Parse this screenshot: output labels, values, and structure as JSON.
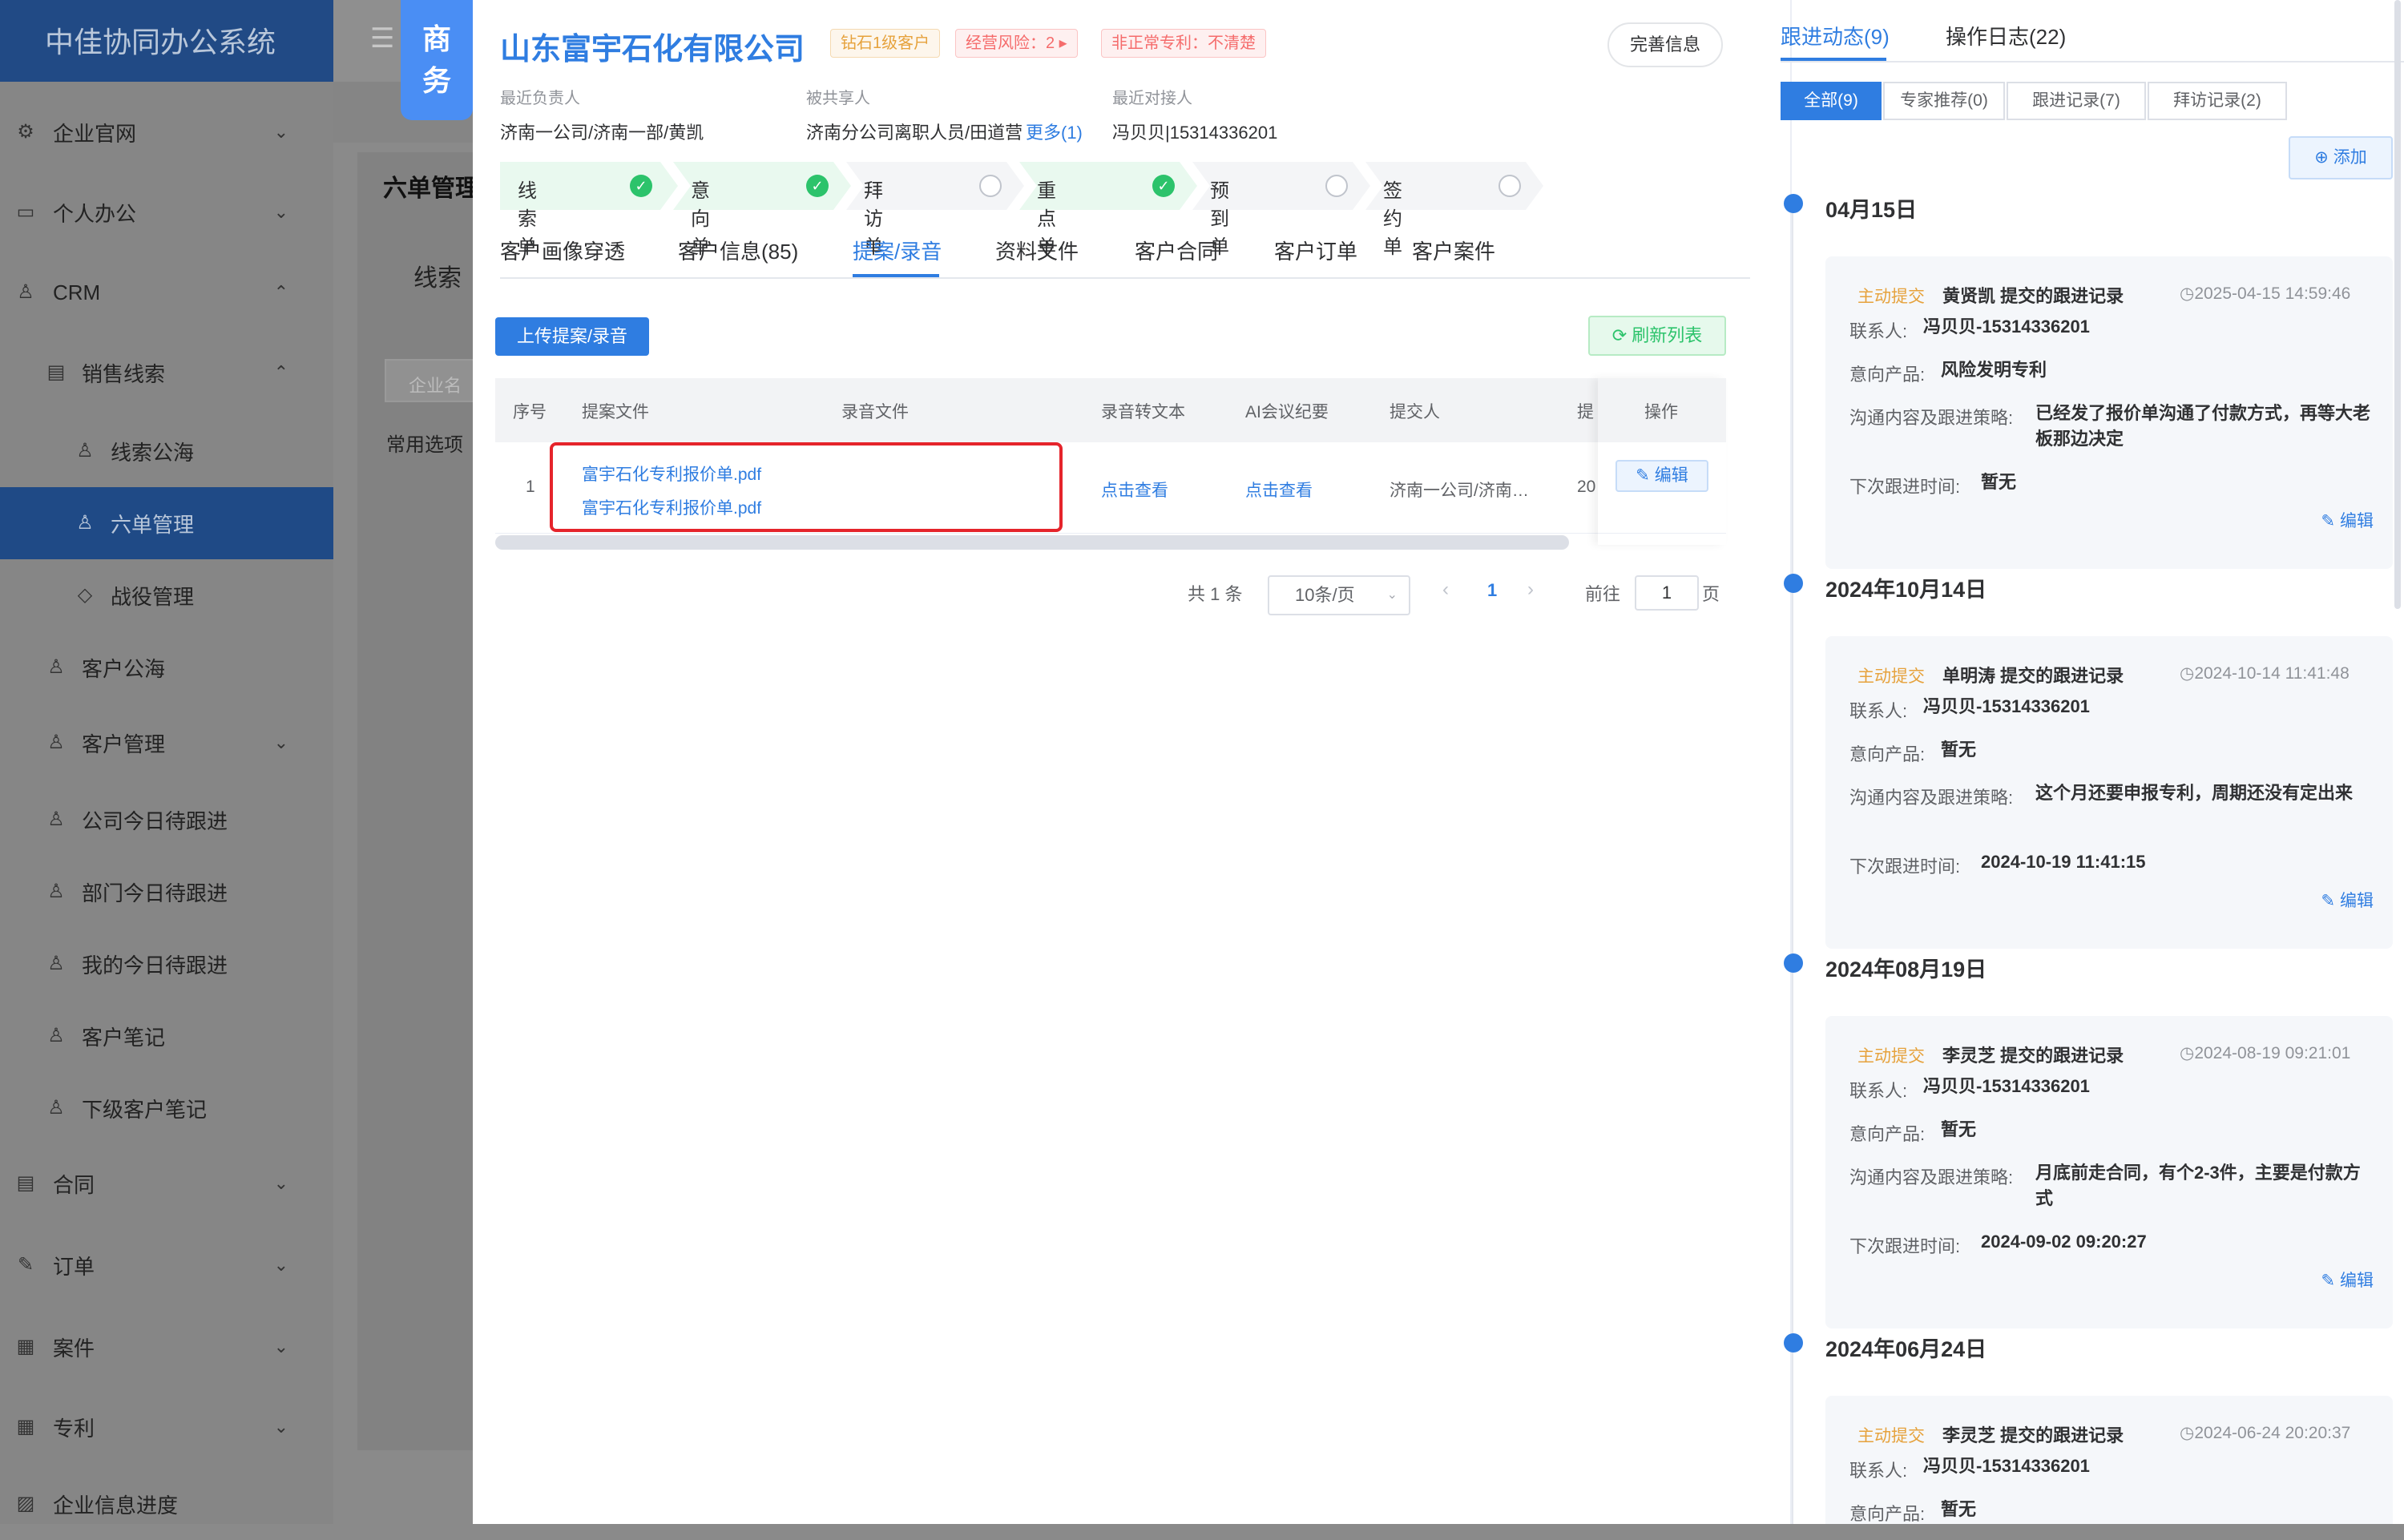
{
  "app": {
    "title": "中佳协同办公系统",
    "menu_icon": "hamburger-icon"
  },
  "sidebar": {
    "items": [
      {
        "label": "企业官网",
        "icon": "gear-icon"
      },
      {
        "label": "个人办公",
        "icon": "monitor-icon"
      },
      {
        "label": "CRM",
        "icon": "user-icon"
      },
      {
        "label": "销售线索",
        "icon": "card-icon"
      },
      {
        "label": "线索公海",
        "icon": "user-icon"
      },
      {
        "label": "六单管理",
        "icon": "user-icon"
      },
      {
        "label": "战役管理",
        "icon": "tag-icon"
      },
      {
        "label": "客户公海",
        "icon": "user-icon"
      },
      {
        "label": "客户管理",
        "icon": "user-icon"
      },
      {
        "label": "公司今日待跟进",
        "icon": "user-icon"
      },
      {
        "label": "部门今日待跟进",
        "icon": "user-icon"
      },
      {
        "label": "我的今日待跟进",
        "icon": "user-icon"
      },
      {
        "label": "客户笔记",
        "icon": "user-icon"
      },
      {
        "label": "下级客户笔记",
        "icon": "user-icon"
      },
      {
        "label": "合同",
        "icon": "card-icon"
      },
      {
        "label": "订单",
        "icon": "edit-icon"
      },
      {
        "label": "案件",
        "icon": "doc-icon"
      },
      {
        "label": "专利",
        "icon": "doc-icon"
      },
      {
        "label": "企业信息进度",
        "icon": "image-icon"
      }
    ]
  },
  "background": {
    "page_title": "六单管理",
    "sub_title": "线索",
    "input_placeholder": "企业名",
    "options_label": "常用选项"
  },
  "drawer": {
    "side_tag": [
      "商",
      "务"
    ],
    "company_name": "山东富宇石化有限公司",
    "badges": [
      "钻石1级客户",
      "经营风险：2 ▸",
      "非正常专利：不清楚"
    ],
    "complete_button": "完善信息",
    "meta": {
      "owner_label": "最近负责人",
      "owner_value": "济南一公司/济南一部/黄凯",
      "shared_label": "被共享人",
      "shared_value": "济南分公司离职人员/田道营",
      "shared_more": "更多(1)",
      "contact_label": "最近对接人",
      "contact_value": "冯贝贝|15314336201"
    },
    "steps": [
      {
        "label": "线索单",
        "done": true
      },
      {
        "label": "意向单",
        "done": true
      },
      {
        "label": "拜访单",
        "done": false
      },
      {
        "label": "重点单",
        "done": true
      },
      {
        "label": "预到单",
        "done": false
      },
      {
        "label": "签约单",
        "done": false
      }
    ],
    "tabs": [
      "客户画像穿透",
      "客户信息(85)",
      "提案/录音",
      "资料文件",
      "客户合同",
      "客户订单",
      "客户案件"
    ],
    "active_tab": "提案/录音",
    "upload_button": "上传提案/录音",
    "refresh_button": "刷新列表",
    "table": {
      "columns": [
        "序号",
        "提案文件",
        "录音文件",
        "录音转文本",
        "AI会议纪要",
        "提交人",
        "提",
        "操作"
      ],
      "rows": [
        {
          "index": "1",
          "proposal_files": [
            "富宇石化专利报价单.pdf",
            "富宇石化专利报价单.pdf"
          ],
          "audio_file": "",
          "transcript": "点击查看",
          "ai_summary": "点击查看",
          "submitter": "济南一公司/济南…",
          "submit_partial": "20",
          "action": "编辑"
        }
      ]
    },
    "pagination": {
      "total": "共 1 条",
      "page_size": "10条/页",
      "current": "1",
      "goto_label": "前往",
      "goto_value": "1",
      "page_suffix": "页"
    }
  },
  "right_panel": {
    "tabs": [
      "跟进动态(9)",
      "操作日志(22)"
    ],
    "filters": [
      "全部(9)",
      "专家推荐(0)",
      "跟进记录(7)",
      "拜访记录(2)"
    ],
    "add_button": "添加",
    "labels": {
      "contact": "联系人:",
      "product": "意向产品:",
      "strategy": "沟通内容及跟进策略:",
      "next_time": "下次跟进时间:",
      "edit": "编辑"
    },
    "timeline": [
      {
        "date": "04月15日",
        "tag": "主动提交",
        "title": "黄贤凯 提交的跟进记录",
        "time": "2025-04-15 14:59:46",
        "contact": "冯贝贝-15314336201",
        "product": "风险发明专利",
        "strategy": "已经发了报价单沟通了付款方式，再等大老板那边决定",
        "next_time": "暂无"
      },
      {
        "date": "2024年10月14日",
        "tag": "主动提交",
        "title": "单明涛 提交的跟进记录",
        "time": "2024-10-14 11:41:48",
        "contact": "冯贝贝-15314336201",
        "product": "暂无",
        "strategy": "这个月还要申报专利，周期还没有定出来",
        "next_time": "2024-10-19 11:41:15"
      },
      {
        "date": "2024年08月19日",
        "tag": "主动提交",
        "title": "李灵芝 提交的跟进记录",
        "time": "2024-08-19 09:21:01",
        "contact": "冯贝贝-15314336201",
        "product": "暂无",
        "strategy": "月底前走合同，有个2-3件，主要是付款方式",
        "next_time": "2024-09-02 09:20:27"
      },
      {
        "date": "2024年06月24日",
        "tag": "主动提交",
        "title": "李灵芝 提交的跟进记录",
        "time": "2024-06-24 20:20:37",
        "contact": "冯贝贝-15314336201",
        "product": "暂无",
        "strategy": "",
        "next_time": ""
      }
    ]
  },
  "colors": {
    "primary": "#2f7de1",
    "success": "#2cc36b",
    "warning": "#e6a23c",
    "danger": "#f56c6c",
    "sidebar_active": "#1f4a86",
    "highlight_border": "#e5242b"
  }
}
